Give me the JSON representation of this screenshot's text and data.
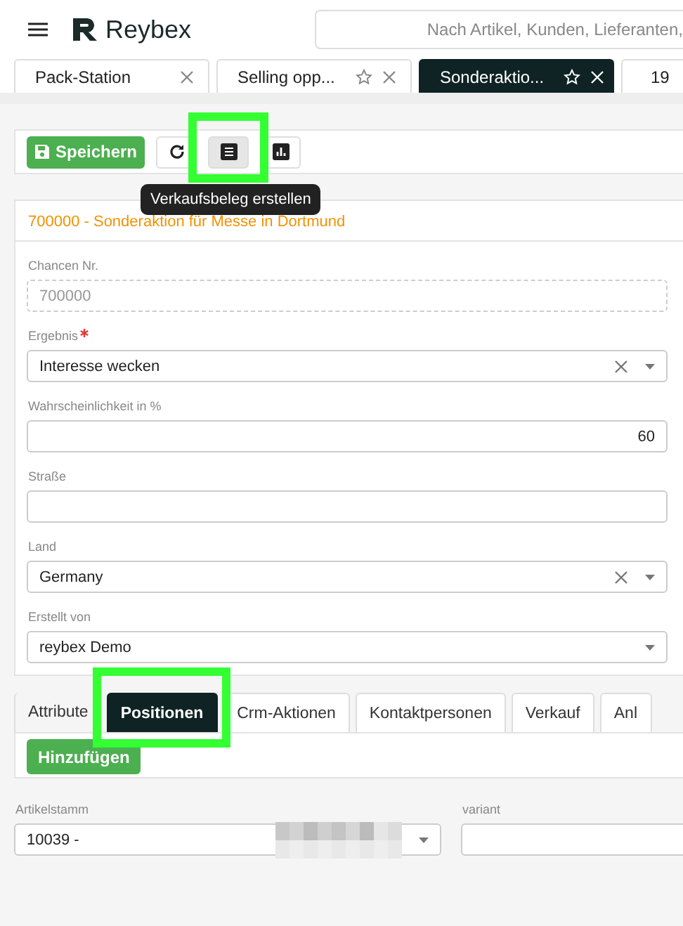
{
  "app": {
    "brand": "Reybex",
    "search": {
      "placeholder": "Nach Artikel, Kunden, Lieferanten,"
    }
  },
  "open_tabs": [
    {
      "label": "Pack-Station",
      "star": false,
      "selected": false
    },
    {
      "label": "Selling opp...",
      "star": true,
      "selected": false
    },
    {
      "label": "Sonderaktio...",
      "star": true,
      "selected": true
    },
    {
      "label": "19",
      "selected": false
    }
  ],
  "toolbar": {
    "buttons": [
      {
        "kind": "save",
        "label": "Speichern",
        "active": false,
        "highlighted": false
      },
      {
        "kind": "refresh",
        "active": false,
        "highlighted": false
      },
      {
        "kind": "document",
        "active": true,
        "highlighted": true,
        "tooltip": "Verkaufsbeleg erstellen"
      },
      {
        "kind": "chart",
        "active": false,
        "highlighted": false
      }
    ]
  },
  "record": {
    "title": "700000 - Sonderaktion für Messe in Dortmund",
    "fields": [
      {
        "label": "Chancen Nr.",
        "value": "700000",
        "kind": "readonly",
        "required": false
      },
      {
        "label": "Ergebnis",
        "value": "Interesse wecken",
        "kind": "select",
        "clearable": true,
        "required": true
      },
      {
        "label": "Wahrscheinlichkeit in %",
        "value": "60",
        "kind": "number",
        "required": false
      },
      {
        "label": "Straße",
        "kind": "text",
        "required": false
      },
      {
        "label": "Land",
        "value": "Germany",
        "kind": "select",
        "clearable": true,
        "required": false
      },
      {
        "label": "Erstellt von",
        "value": "reybex Demo",
        "kind": "select",
        "clearable": false,
        "required": false
      }
    ]
  },
  "detail_tabs": [
    {
      "label": "Attribute",
      "selected": false,
      "highlighted": false
    },
    {
      "label": "Positionen",
      "selected": true,
      "highlighted": true
    },
    {
      "label": "Crm-Aktionen",
      "selected": false,
      "highlighted": false
    },
    {
      "label": "Kontaktpersonen",
      "selected": false,
      "highlighted": false
    },
    {
      "label": "Verkauf",
      "selected": false,
      "highlighted": false
    },
    {
      "label": "Anl",
      "selected": false,
      "highlighted": false
    }
  ],
  "positions": {
    "add_button": "Hinzufügen",
    "fields": [
      {
        "label": "Artikelstamm",
        "value": "10039 -",
        "kind": "select",
        "redacted": true
      },
      {
        "label": "variant",
        "kind": "text",
        "redacted": false
      }
    ]
  }
}
